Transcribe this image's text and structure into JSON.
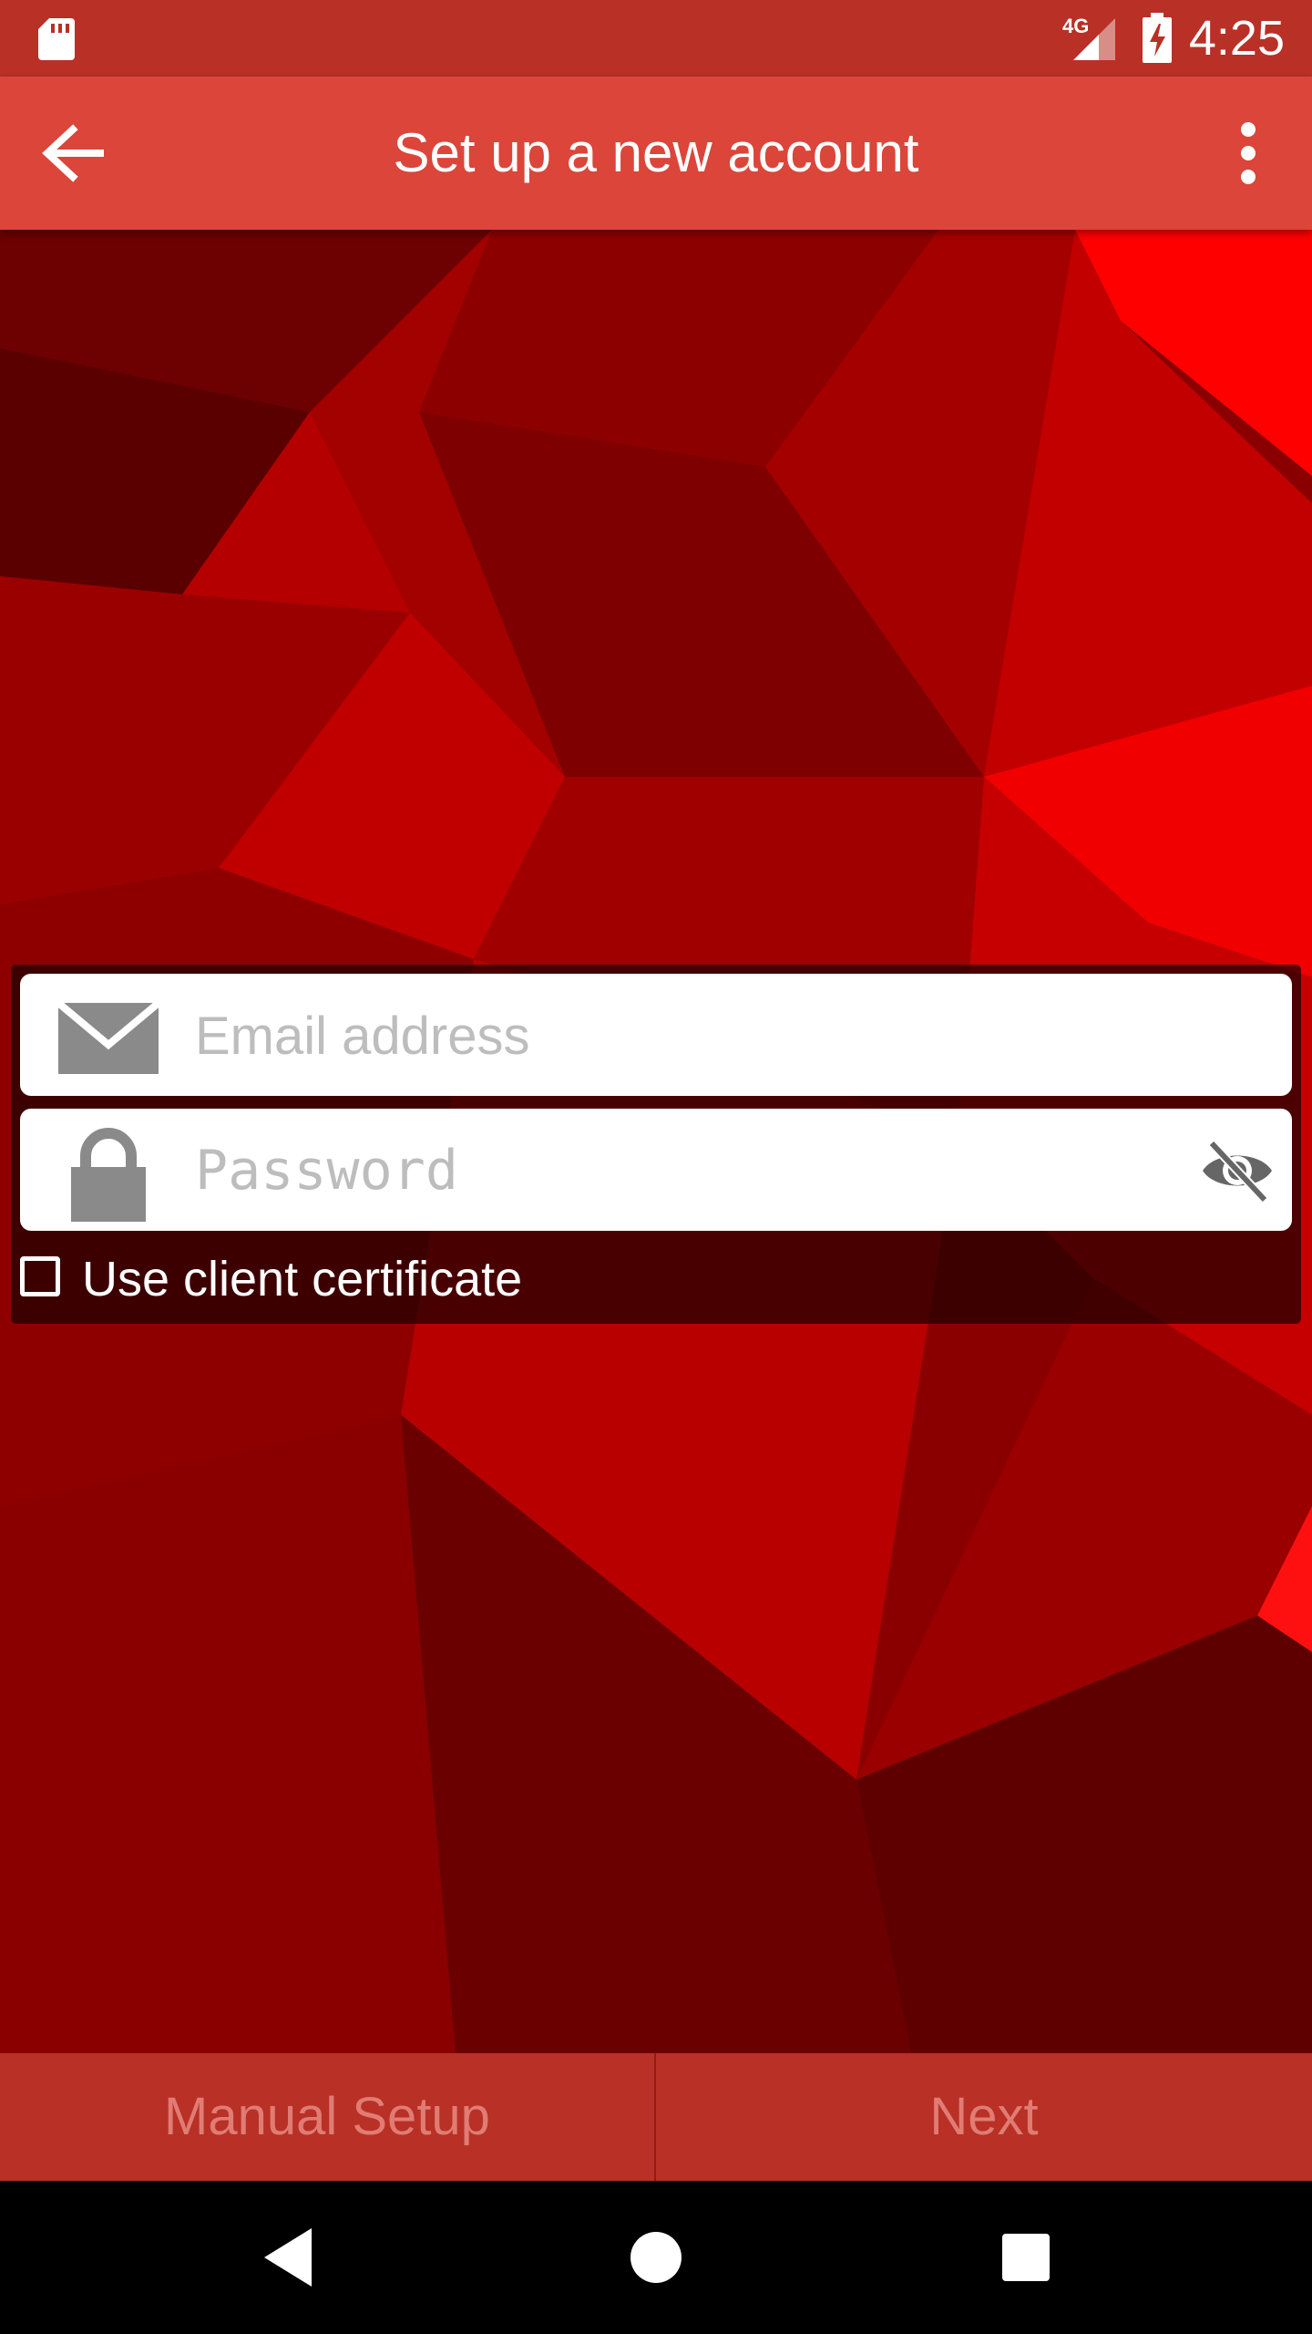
{
  "status_bar": {
    "network_type": "4G",
    "time": "4:25",
    "icons": [
      "sd-card-icon",
      "cellular-signal-icon",
      "battery-charging-icon"
    ]
  },
  "app_bar": {
    "title": "Set up a new account",
    "back_icon": "arrow-back-icon",
    "menu_icon": "more-vert-icon"
  },
  "form": {
    "email": {
      "placeholder": "Email address",
      "value": "",
      "icon": "envelope-icon"
    },
    "password": {
      "placeholder": "Password",
      "value": "",
      "icon": "lock-icon",
      "toggle_icon": "eye-off-icon"
    },
    "client_certificate": {
      "label": "Use client certificate",
      "checked": false
    }
  },
  "actions": {
    "manual_setup": "Manual Setup",
    "next": "Next"
  },
  "nav_bar": {
    "icons": [
      "nav-back-icon",
      "nav-home-icon",
      "nav-recent-icon"
    ]
  },
  "colors": {
    "status_bar": "#b93026",
    "app_bar": "#db453a",
    "background": "#8a0000",
    "action_bar": "#b93026",
    "action_text_disabled": "#e07c73"
  }
}
